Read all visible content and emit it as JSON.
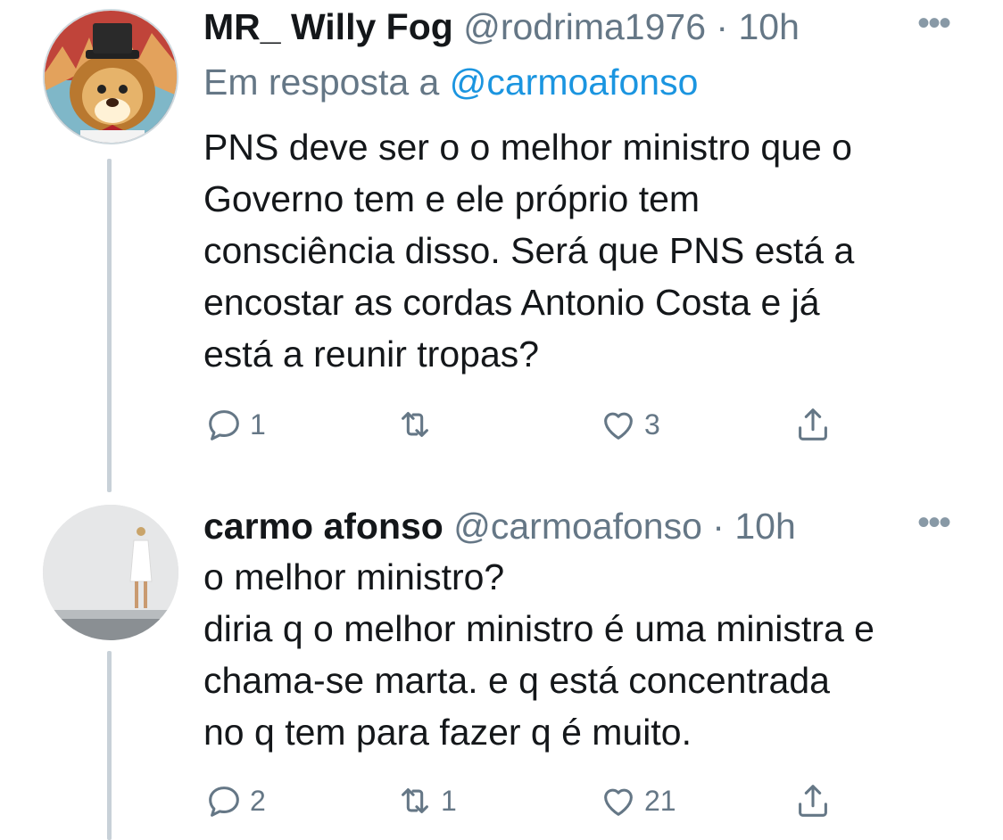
{
  "tweets": [
    {
      "display_name": "MR_ Willy Fog",
      "handle": "@rodrima1976",
      "separator": "·",
      "time": "10h",
      "more": "•••",
      "reply_prefix": "Em resposta a",
      "reply_mention": "@carmoafonso",
      "body_lines": [
        "PNS deve ser o o melhor ministro que o",
        "Governo tem e ele próprio tem",
        "consciência disso. Será que PNS está a",
        "encostar as cordas Antonio Costa e já",
        "está a reunir tropas?"
      ],
      "actions": {
        "replies": "1",
        "retweets": "",
        "likes": "3"
      }
    },
    {
      "display_name": "carmo afonso",
      "handle": "@carmoafonso",
      "separator": "·",
      "time": "10h",
      "more": "•••",
      "body_lines": [
        "o melhor ministro?",
        "diria q o melhor ministro é uma ministra e",
        "chama-se marta. e q está concentrada",
        "no q tem para fazer q é muito."
      ],
      "actions": {
        "replies": "2",
        "retweets": "1",
        "likes": "21"
      }
    }
  ],
  "icons": {
    "reply": "reply-icon",
    "retweet": "retweet-icon",
    "like": "heart-icon",
    "share": "share-icon"
  },
  "colors": {
    "text": "#14171a",
    "secondary": "#657786",
    "link": "#1b95e0",
    "thread_line": "#c8d1d8"
  }
}
